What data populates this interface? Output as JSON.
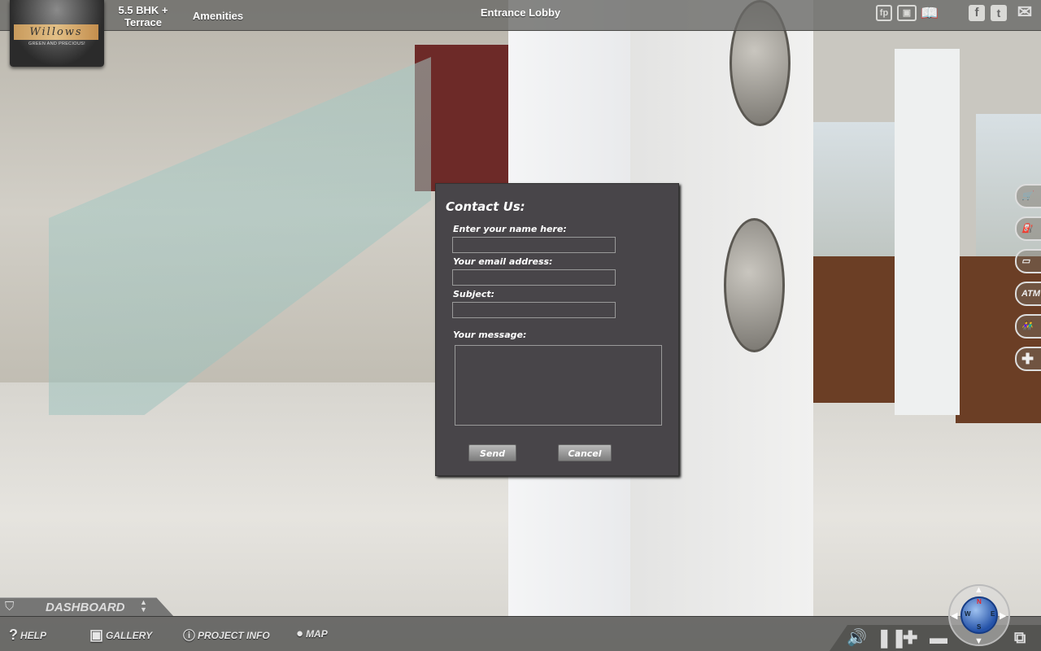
{
  "header": {
    "logo_text": "Willows",
    "logo_tagline": "GREEN AND PRECIOUS!",
    "nav": [
      "5.5 BHK +",
      "Terrace",
      "Amenities"
    ],
    "scene_title": "Entrance Lobby",
    "tool_icons": [
      "floorplan-icon",
      "gallery-icon",
      "book-icon"
    ],
    "tool_labels": {
      "floorplan": "fp"
    },
    "social_icons": [
      "facebook-icon",
      "twitter-icon",
      "email-icon"
    ]
  },
  "side_icons": [
    {
      "icon": "shopping-cart-icon",
      "label": ""
    },
    {
      "icon": "fuel-pump-icon",
      "label": ""
    },
    {
      "icon": "bus-icon",
      "label": ""
    },
    {
      "icon": "atm-icon",
      "label": "ATM"
    },
    {
      "icon": "school-children-icon",
      "label": ""
    },
    {
      "icon": "hospital-cross-icon",
      "label": ""
    }
  ],
  "contact_form": {
    "title": "Contact Us:",
    "name_label": "Enter your name here:",
    "name_value": "",
    "email_label": "Your email address:",
    "email_value": "",
    "subject_label": "Subject:",
    "subject_value": "",
    "message_label": "Your message:",
    "message_value": "",
    "send_label": "Send",
    "cancel_label": "Cancel"
  },
  "footer": {
    "dashboard_label": "DASHBOARD",
    "items": [
      {
        "label": "HELP",
        "icon": "question-icon"
      },
      {
        "label": "GALLERY",
        "icon": "gallery-icon"
      },
      {
        "label": "PROJECT INFO",
        "icon": "info-icon"
      },
      {
        "label": "MAP",
        "icon": "globe-icon"
      }
    ],
    "controls": [
      "volume-icon",
      "pause-icon",
      "zoom-in-icon",
      "zoom-out-icon",
      "fullscreen-icon"
    ],
    "compass_letters": {
      "n": "N",
      "w": "W",
      "e": "E",
      "s": "S"
    }
  }
}
